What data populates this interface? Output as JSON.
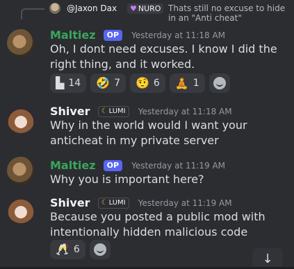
{
  "reply_preview": {
    "username": "@Jaxon Dax",
    "tag": "NURO",
    "text": "Thats still no excuse to hide in an \"Anti cheat\""
  },
  "messages": [
    {
      "author": "Maltiez",
      "badge": "OP",
      "timestamp": "Yesterday at 11:18 AM",
      "text": "Oh, I dont need excuses. I know I did the right thing, and it worked.",
      "reactions": [
        {
          "emoji": "▙",
          "count": "14"
        },
        {
          "emoji": "🤣",
          "count": "7"
        },
        {
          "emoji": "🤨",
          "count": "6"
        },
        {
          "emoji": "🧘",
          "count": "1"
        }
      ]
    },
    {
      "author": "Shiver",
      "badge": "LUMI",
      "timestamp": "Yesterday at 11:18 AM",
      "text": "Why in the world would I want your anticheat in my private server"
    },
    {
      "author": "Maltiez",
      "badge": "OP",
      "timestamp": "Yesterday at 11:19 AM",
      "text": "Why you is important here?"
    },
    {
      "author": "Shiver",
      "badge": "LUMI",
      "timestamp": "Yesterday at 11:19 AM",
      "text": "Because you posted a public mod with intentionally hidden malicious code",
      "reactions": [
        {
          "emoji": "🥂",
          "count": "6"
        }
      ]
    }
  ],
  "colors": {
    "op_name": "#3ba55c",
    "op_badge": "#5865f2",
    "background": "#2b2d31"
  }
}
